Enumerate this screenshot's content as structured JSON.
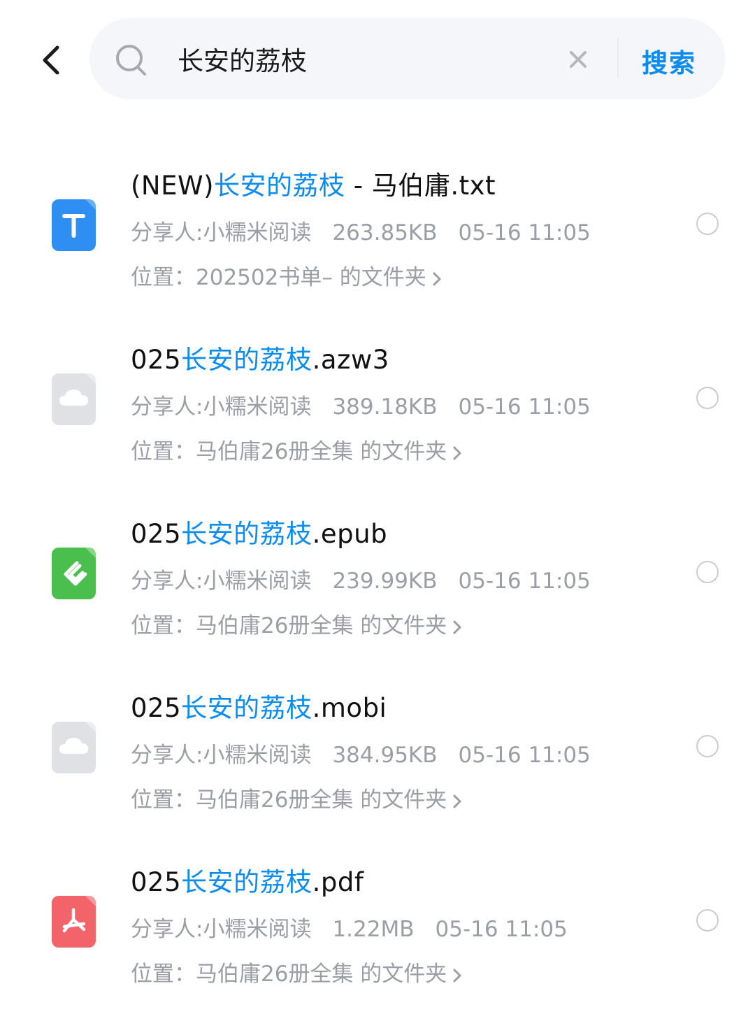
{
  "search": {
    "query": "长安的荔枝",
    "button_label": "搜索"
  },
  "colors": {
    "accent": "#0a8cf0",
    "txt_icon": "#2f8ef2",
    "epub_icon": "#4bbf4d",
    "pdf_icon": "#f2636a",
    "generic_icon": "#dfe1e5"
  },
  "results": [
    {
      "icon": "txt-file-icon",
      "name_prefix": "(NEW)",
      "name_highlight": "长安的荔枝",
      "name_suffix": " - 马伯庸.txt",
      "sharer": "分享人:小糯米阅读",
      "size": "263.85KB",
      "time": "05-16 11:05",
      "location": "位置：202502书单– 的文件夹"
    },
    {
      "icon": "cloud-file-icon",
      "name_prefix": "025",
      "name_highlight": "长安的荔枝",
      "name_suffix": ".azw3",
      "sharer": "分享人:小糯米阅读",
      "size": "389.18KB",
      "time": "05-16 11:05",
      "location": "位置：马伯庸26册全集 的文件夹"
    },
    {
      "icon": "epub-file-icon",
      "name_prefix": "025",
      "name_highlight": "长安的荔枝",
      "name_suffix": ".epub",
      "sharer": "分享人:小糯米阅读",
      "size": "239.99KB",
      "time": "05-16 11:05",
      "location": "位置：马伯庸26册全集 的文件夹"
    },
    {
      "icon": "cloud-file-icon",
      "name_prefix": "025",
      "name_highlight": "长安的荔枝",
      "name_suffix": ".mobi",
      "sharer": "分享人:小糯米阅读",
      "size": "384.95KB",
      "time": "05-16 11:05",
      "location": "位置：马伯庸26册全集 的文件夹"
    },
    {
      "icon": "pdf-file-icon",
      "name_prefix": "025",
      "name_highlight": "长安的荔枝",
      "name_suffix": ".pdf",
      "sharer": "分享人:小糯米阅读",
      "size": "1.22MB",
      "time": "05-16 11:05",
      "location": "位置：马伯庸26册全集 的文件夹"
    }
  ]
}
